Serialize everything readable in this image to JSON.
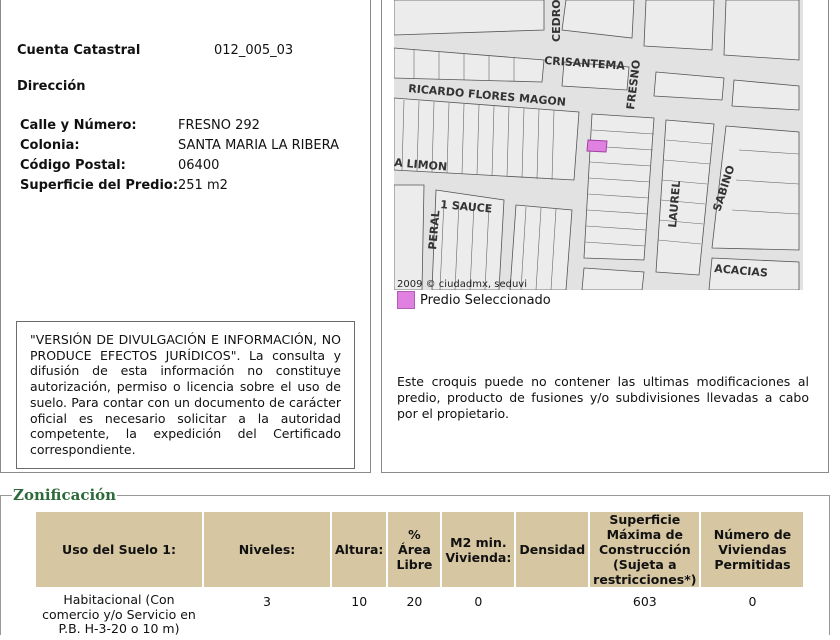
{
  "predio": {
    "cuenta_label": "Cuenta Catastral",
    "cuenta_value": "012_005_03",
    "direccion_label": "Dirección",
    "calle_label": "Calle y Número:",
    "calle_value": "FRESNO 292",
    "colonia_label": "Colonia:",
    "colonia_value": "SANTA MARIA LA RIBERA",
    "cp_label": "Código Postal:",
    "cp_value": "06400",
    "superficie_label": "Superficie del Predio:",
    "superficie_value": "251 m2"
  },
  "notice": "\"VERSIÓN DE DIVULGACIÓN E INFORMACIÓN, NO PRODUCE EFECTOS JURÍDICOS\". La consulta y difusión de esta información no constituye autorización, permiso o licencia sobre el uso de suelo. Para contar con un documento de carácter oficial es necesario solicitar a la autoridad competente, la expedición del Certificado correspondiente.",
  "map": {
    "streets": [
      "CEDRO",
      "CRISANTEMA",
      "FRESNO",
      "RICARDO FLORES MAGON",
      "A LIMON",
      "1 SAUCE",
      "PERAL",
      "LAUREL",
      "SABINO",
      "ACACIAS"
    ],
    "credit": "2009 © ciudadmx, seduvi",
    "highlight_color": "#e080e0"
  },
  "legend_label": "Predio Seleccionado",
  "croquis_note": "Este croquis puede no contener las ultimas modificaciones al predio, producto de fusiones y/o subdivisiones llevadas a cabo por el propietario.",
  "zonificacion": {
    "title": "Zonificación",
    "headers": [
      "Uso del Suelo 1:",
      "Niveles:",
      "Altura:",
      "% Área Libre",
      "M2 min. Vivienda:",
      "Densidad",
      "Superficie Máxima de Construcción (Sujeta a restricciones*)",
      "Número de Viviendas Permitidas"
    ],
    "row": [
      "Habitacional (Con comercio y/o Servicio en P.B. H-3-20 o 10 m)",
      "3",
      "10",
      "20",
      "0",
      "",
      "603",
      "0"
    ],
    "header_color": "#d6c6a1",
    "title_color": "#2e6a3a"
  }
}
